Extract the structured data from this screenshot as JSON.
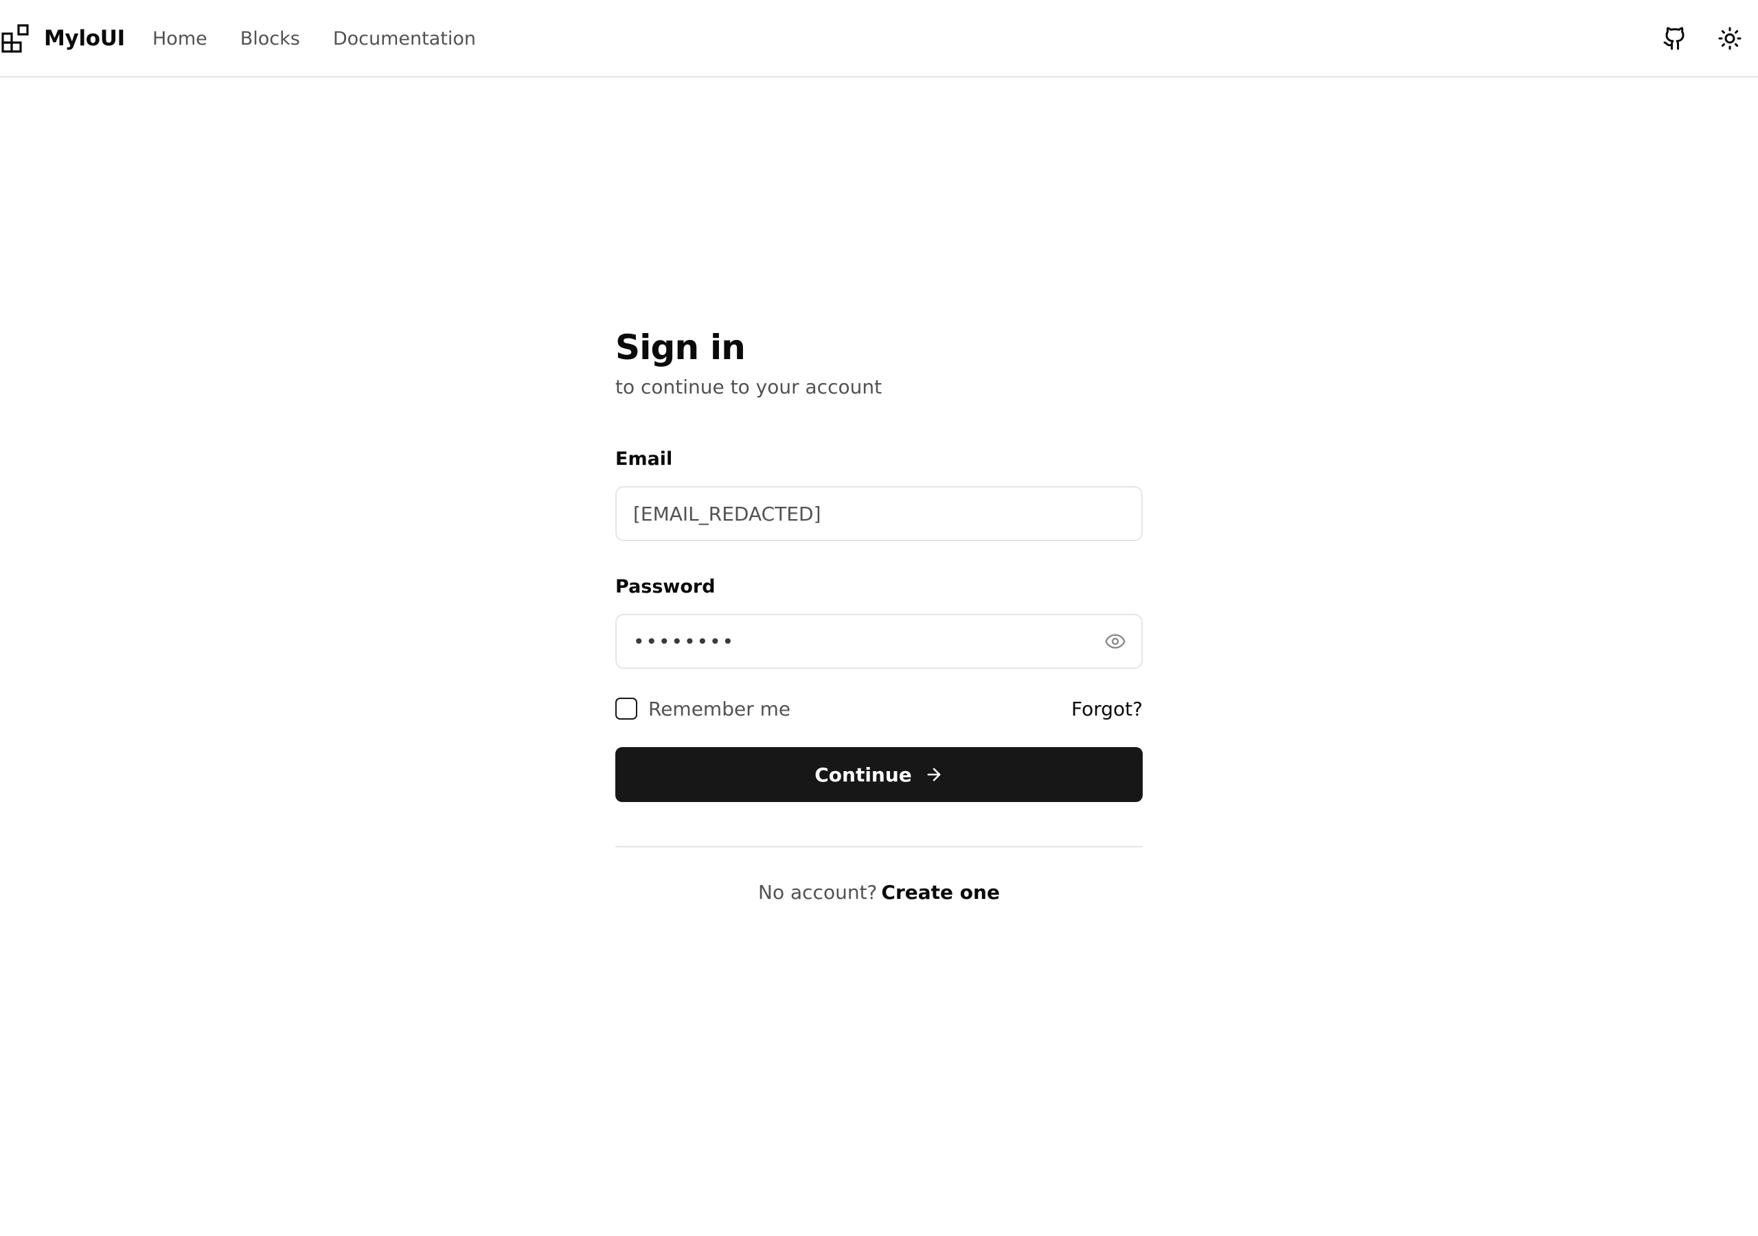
{
  "header": {
    "brand_name": "MyloUI",
    "brand_icon": "blocks-logo-icon",
    "nav": [
      {
        "label": "Home"
      },
      {
        "label": "Blocks"
      },
      {
        "label": "Documentation"
      }
    ],
    "github_icon": "github-icon",
    "theme_icon": "sun-icon"
  },
  "auth": {
    "title": "Sign in",
    "subtitle": "to continue to your account",
    "email": {
      "label": "Email",
      "value": "[EMAIL_REDACTED]"
    },
    "password": {
      "label": "Password",
      "value": "password",
      "toggle_icon": "eye-icon"
    },
    "remember_label": "Remember me",
    "remember_checked": false,
    "forgot_label": "Forgot?",
    "continue_label": "Continue",
    "continue_icon": "arrow-right-icon",
    "signup_prompt": "No account?",
    "signup_link": "Create one"
  },
  "colors": {
    "primary": "#171717",
    "border": "#e5e5e5",
    "muted_text": "#525252",
    "background": "#ffffff"
  }
}
